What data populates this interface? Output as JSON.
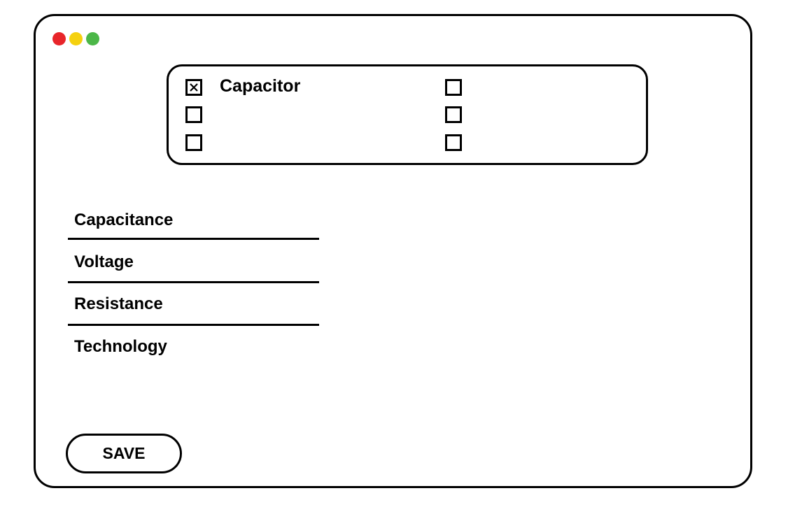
{
  "window": {
    "dots": [
      {
        "name": "close-dot",
        "color": "#e8252a"
      },
      {
        "name": "minimize-dot",
        "color": "#f5d10f"
      },
      {
        "name": "maximize-dot",
        "color": "#4cb748"
      }
    ]
  },
  "component_selector": {
    "options": [
      {
        "label": "Capacitor",
        "checked": true
      },
      {
        "label": "",
        "checked": false
      },
      {
        "label": "",
        "checked": false
      },
      {
        "label": "",
        "checked": false
      },
      {
        "label": "",
        "checked": false
      },
      {
        "label": "",
        "checked": false
      }
    ]
  },
  "fields": [
    {
      "label": "Capacitance"
    },
    {
      "label": "Voltage"
    },
    {
      "label": "Resistance"
    },
    {
      "label": "Technology"
    }
  ],
  "actions": {
    "save_label": "SAVE"
  },
  "colors": {
    "stroke": "#000000",
    "background": "#ffffff"
  }
}
